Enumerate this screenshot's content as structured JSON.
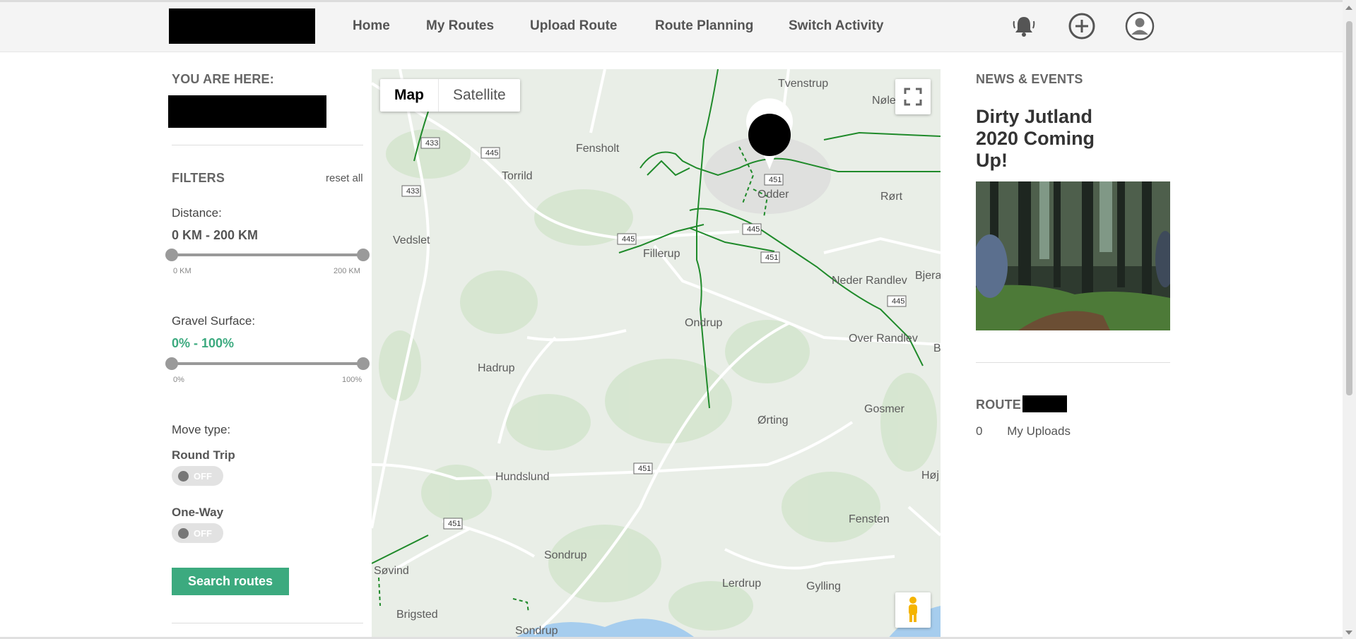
{
  "nav": {
    "links": [
      "Home",
      "My Routes",
      "Upload Route",
      "Route Planning",
      "Switch Activity"
    ],
    "icons": [
      "bell-icon",
      "plus-circle-icon",
      "user-avatar-icon"
    ]
  },
  "sidebar": {
    "you_are_here": "YOU ARE HERE:",
    "filters_title": "FILTERS",
    "reset_all": "reset all",
    "distance": {
      "label": "Distance:",
      "value": "0 KM - 200 KM",
      "min_label": "0 KM",
      "max_label": "200 KM"
    },
    "gravel": {
      "label": "Gravel Surface:",
      "value": "0% - 100%",
      "min_label": "0%",
      "max_label": "100%"
    },
    "move_type": {
      "label": "Move type:",
      "round_trip": {
        "label": "Round Trip",
        "state": "OFF"
      },
      "one_way": {
        "label": "One-Way",
        "state": "OFF"
      }
    },
    "search_button": "Search routes"
  },
  "map": {
    "controls": {
      "map_label": "Map",
      "satellite_label": "Satellite"
    },
    "places": [
      "Tvenstrup",
      "Nøle",
      "Fensholt",
      "Torrild",
      "Odder",
      "Rørt",
      "Vedslet",
      "Fillerup",
      "Neder Randlev",
      "Bjera",
      "Ondrup",
      "Over Randlev",
      "B",
      "Hadrup",
      "Gosmer",
      "Ørting",
      "Hundslund",
      "Høj",
      "Fensten",
      "Sondrup",
      "Søvind",
      "Lerdrup",
      "Gylling",
      "Brigsted",
      "Sondrup"
    ],
    "road_shields": [
      "433",
      "445",
      "433",
      "451",
      "445",
      "445",
      "451",
      "445",
      "451",
      "451"
    ]
  },
  "news": {
    "heading": "NEWS & EVENTS",
    "title": "Dirty Jutland 2020 Coming Up!"
  },
  "route_stats": {
    "heading": "ROUTE",
    "uploads_count": "0",
    "uploads_label": "My Uploads"
  },
  "colors": {
    "accent": "#3caa7f",
    "route_line": "#1f8a2a"
  }
}
